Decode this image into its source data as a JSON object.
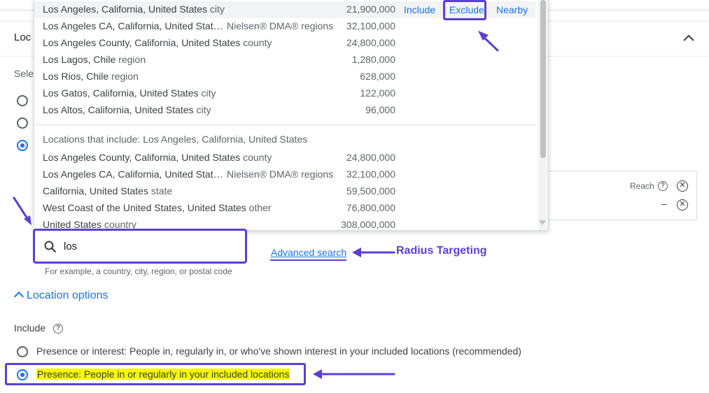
{
  "panel": {
    "title": "Loc",
    "select_label": "Sele"
  },
  "reach": {
    "label": "Reach",
    "dash": "–"
  },
  "dropdown": {
    "rows": [
      {
        "name": "Los Angeles, California, United States",
        "type": "city",
        "dma": "",
        "value": "21,900,000"
      },
      {
        "name": "Los Angeles CA, California, United Stat…",
        "type": "",
        "dma": "Nielsen® DMA® regions",
        "value": "32,100,000"
      },
      {
        "name": "Los Angeles County, California, United States",
        "type": "county",
        "dma": "",
        "value": "24,800,000"
      },
      {
        "name": "Los Lagos, Chile",
        "type": "region",
        "dma": "",
        "value": "1,280,000"
      },
      {
        "name": "Los Rios, Chile",
        "type": "region",
        "dma": "",
        "value": "628,000"
      },
      {
        "name": "Los Gatos, California, United States",
        "type": "city",
        "dma": "",
        "value": "122,000"
      },
      {
        "name": "Los Altos, California, United States",
        "type": "city",
        "dma": "",
        "value": "96,000"
      }
    ],
    "actions": {
      "include": "Include",
      "exclude": "Exclude",
      "nearby": "Nearby"
    },
    "section_heading": "Locations that include: Los Angeles, California, United States",
    "section_rows": [
      {
        "name": "Los Angeles County, California, United States",
        "type": "county",
        "dma": "",
        "value": "24,800,000"
      },
      {
        "name": "Los Angeles CA, California, United Stat…",
        "type": "",
        "dma": "Nielsen® DMA® regions",
        "value": "32,100,000"
      },
      {
        "name": "California, United States",
        "type": "state",
        "dma": "",
        "value": "59,500,000"
      },
      {
        "name": "West Coast of the United States, United States",
        "type": "other",
        "dma": "",
        "value": "76,800,000"
      },
      {
        "name": "United States",
        "type": "country",
        "dma": "",
        "value": "308,000,000"
      }
    ]
  },
  "search": {
    "value": "los",
    "hint": "For example, a country, city, region, or postal code"
  },
  "advanced_search": "Advanced search",
  "annotation": {
    "radius_label": "Radius Targeting"
  },
  "location_options": {
    "title": "Location options",
    "include_label": "Include",
    "options": [
      {
        "label": "Presence or interest: People in, regularly in, or who've shown interest in your included locations (recommended)",
        "selected": false
      },
      {
        "label": "Presence: People in or regularly in your included locations",
        "selected": true
      }
    ]
  },
  "colors": {
    "accent": "#1a73e8",
    "annotation": "#5b3fd6",
    "highlight": "#f7f700"
  }
}
